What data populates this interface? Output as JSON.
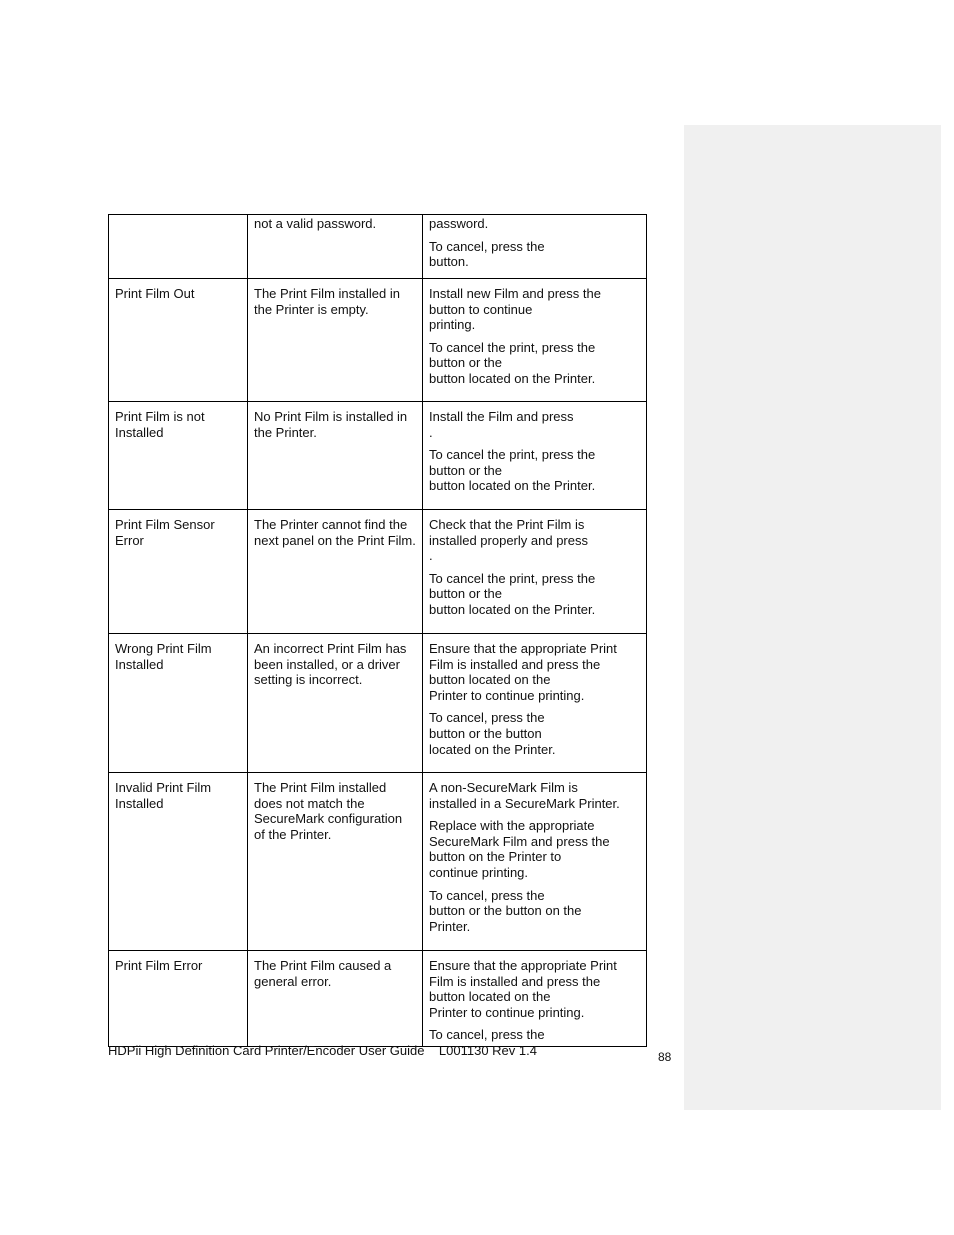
{
  "table": {
    "rows": [
      {
        "error": "",
        "description": "not a valid password.",
        "action": [
          "password.",
          "To cancel, press the\nbutton."
        ]
      },
      {
        "error": "Print Film Out",
        "description": "The Print Film installed in the Printer is empty.",
        "action": [
          "Install new Film and press the\n               button to continue\nprinting.",
          "To cancel the print, press the\n                        button or the\nbutton located on the Printer."
        ]
      },
      {
        "error": "Print Film is not Installed",
        "description": "No Print Film is installed in the Printer.",
        "action": [
          "Install the Film and press\n                 .",
          "To cancel the print, press the\n                        button or the\nbutton located on the Printer."
        ]
      },
      {
        "error": "Print Film Sensor Error",
        "description": "The Printer cannot find the next panel on the Print Film.",
        "action": [
          "Check that the Print Film is\ninstalled properly and press\n                 .",
          "To cancel the print, press the\n                        button or the\nbutton located on the Printer."
        ]
      },
      {
        "error": "Wrong Print Film Installed",
        "description": "An incorrect Print Film has been installed, or a driver setting is incorrect.",
        "action": [
          "Ensure that the appropriate Print\nFilm is installed and press the\n               button located on the\nPrinter to continue printing.",
          "To cancel, press the\nbutton or the              button\nlocated on the Printer."
        ]
      },
      {
        "error": "Invalid Print Film Installed",
        "description": "The Print Film installed does not match the SecureMark configuration of the Printer.",
        "action": [
          "A non-SecureMark Film is\ninstalled in a SecureMark Printer.",
          "Replace with the appropriate\nSecureMark Film and press the\n               button on the Printer to\ncontinue printing.",
          "To cancel, press the\nbutton or the              button on the\nPrinter."
        ]
      },
      {
        "error": "Print Film Error",
        "description": "The Print Film caused a general error.",
        "action": [
          "Ensure that the appropriate Print\nFilm is installed and press the\n               button located on the\nPrinter to continue printing.",
          "To cancel, press the"
        ]
      }
    ]
  },
  "footer": {
    "text": "HDPii High Definition Card Printer/Encoder User Guide    L001130 Rev 1.4",
    "page_number": "88"
  }
}
